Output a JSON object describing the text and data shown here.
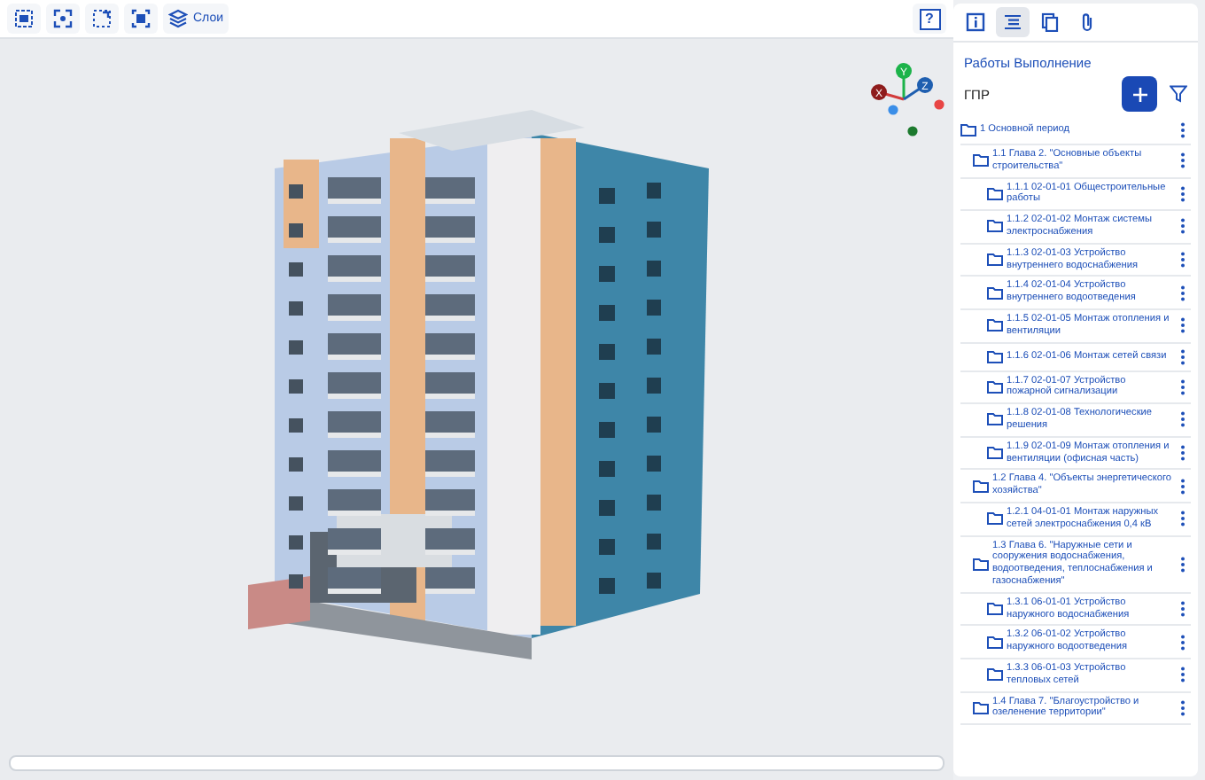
{
  "toolbar": {
    "buttons": [
      {
        "kind": "select"
      },
      {
        "kind": "fit"
      },
      {
        "kind": "zoom-region"
      },
      {
        "kind": "fullscreen"
      },
      {
        "kind": "layers",
        "label": "Слои"
      }
    ],
    "help": "?"
  },
  "viewer": {
    "axes": [
      "X",
      "Y",
      "Z"
    ]
  },
  "panel": {
    "tabs": [
      {
        "kind": "info",
        "selected": false
      },
      {
        "kind": "list",
        "selected": true
      },
      {
        "kind": "documents",
        "selected": false
      },
      {
        "kind": "attachment",
        "selected": false
      }
    ],
    "title": "Работы Выполнение",
    "subtitle": "ГПР",
    "tree": [
      {
        "label": "1 Основной период",
        "children": [
          {
            "label": "1.1 Глава 2. \"Основные объекты строительства\"",
            "children": [
              {
                "label": "1.1.1 02-01-01 Общестроительные работы"
              },
              {
                "label": "1.1.2 02-01-02 Монтаж системы электроснабжения"
              },
              {
                "label": "1.1.3 02-01-03 Устройство внутреннего водоснабжения"
              },
              {
                "label": "1.1.4 02-01-04 Устройство внутреннего водоотведения"
              },
              {
                "label": "1.1.5 02-01-05 Монтаж отопления и вентиляции"
              },
              {
                "label": "1.1.6 02-01-06 Монтаж сетей связи"
              },
              {
                "label": "1.1.7 02-01-07 Устройство пожарной сигнализации"
              },
              {
                "label": "1.1.8 02-01-08 Технологические решения"
              },
              {
                "label": "1.1.9 02-01-09 Монтаж отопления и вентиляции (офисная часть)"
              }
            ]
          },
          {
            "label": "1.2 Глава 4. \"Объекты энергетического хозяйства\"",
            "children": [
              {
                "label": "1.2.1 04-01-01 Монтаж наружных сетей электроснабжения 0,4 кВ"
              }
            ]
          },
          {
            "label": "1.3 Глава 6. \"Наружные сети и сооружения водоснабжения, водоотведения, теплоснабжения и газоснабжения\"",
            "children": [
              {
                "label": "1.3.1 06-01-01 Устройство наружного водоснабжения"
              },
              {
                "label": "1.3.2 06-01-02 Устройство наружного водоотведения"
              },
              {
                "label": "1.3.3 06-01-03 Устройство тепловых сетей"
              }
            ]
          },
          {
            "label": "1.4 Глава 7. \"Благоустройство и озеленение территории\""
          }
        ]
      }
    ]
  }
}
